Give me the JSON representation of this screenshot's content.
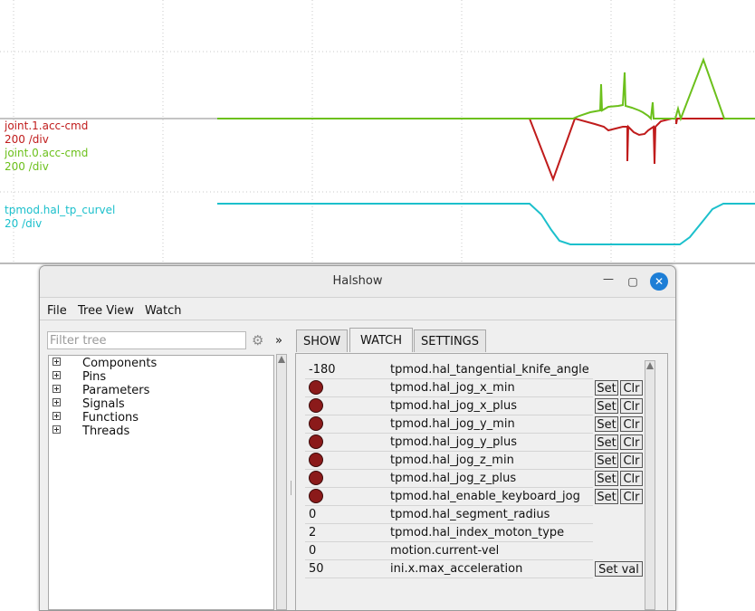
{
  "scope": {
    "traces": [
      {
        "name": "joint.1.acc-cmd",
        "scale": "200 /div",
        "color": "#c01c1c"
      },
      {
        "name": "joint.0.acc-cmd",
        "scale": "200 /div",
        "color": "#6cc01c"
      },
      {
        "name": "tpmod.hal_tp_curvel",
        "scale": "20 /div",
        "color": "#1cc0cc"
      }
    ]
  },
  "window": {
    "title": "Halshow",
    "minimize_glyph": "—",
    "maximize_glyph": "▢",
    "close_glyph": "✕"
  },
  "menu": {
    "items": [
      "File",
      "Tree View",
      "Watch"
    ]
  },
  "filter": {
    "placeholder": "Filter tree",
    "collapse_glyph": "»",
    "settings_glyph": "⚙"
  },
  "tree": {
    "items": [
      "Components",
      "Pins",
      "Parameters",
      "Signals",
      "Functions",
      "Threads"
    ]
  },
  "tabs": [
    {
      "label": "SHOW",
      "active": false
    },
    {
      "label": "WATCH",
      "active": true
    },
    {
      "label": "SETTINGS",
      "active": false
    }
  ],
  "watch": {
    "set_label": "Set",
    "clr_label": "Clr",
    "setval_label": "Set val",
    "led_color": "#8b1a1a",
    "rows": [
      {
        "value": "-180",
        "name": "tpmod.hal_tangential_knife_angle"
      },
      {
        "value": "",
        "name": "tpmod.hal_jog_x_min"
      },
      {
        "value": "",
        "name": "tpmod.hal_jog_x_plus"
      },
      {
        "value": "",
        "name": "tpmod.hal_jog_y_min"
      },
      {
        "value": "",
        "name": "tpmod.hal_jog_y_plus"
      },
      {
        "value": "",
        "name": "tpmod.hal_jog_z_min"
      },
      {
        "value": "",
        "name": "tpmod.hal_jog_z_plus"
      },
      {
        "value": "",
        "name": "tpmod.hal_enable_keyboard_jog"
      },
      {
        "value": "0",
        "name": "tpmod.hal_segment_radius"
      },
      {
        "value": "2",
        "name": "tpmod.hal_index_moton_type"
      },
      {
        "value": "0",
        "name": "motion.current-vel"
      },
      {
        "value": "50",
        "name": "ini.x.max_acceleration"
      }
    ]
  }
}
